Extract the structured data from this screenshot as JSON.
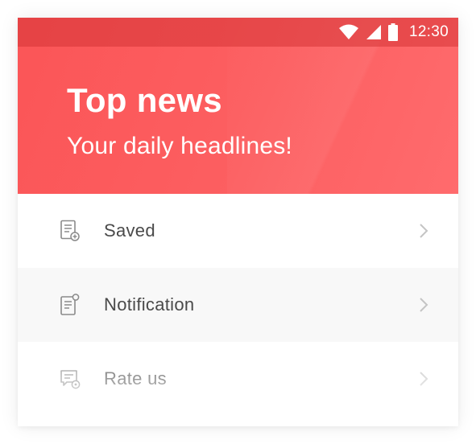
{
  "status_bar": {
    "time": "12:30",
    "icons": [
      "wifi-icon",
      "cell-signal-icon",
      "battery-icon"
    ]
  },
  "header": {
    "title": "Top news",
    "subtitle": "Your daily headlines!",
    "colors": {
      "accent": "#fb5557",
      "accent_light": "#ff6b6d"
    }
  },
  "menu": {
    "items": [
      {
        "label": "Saved",
        "icon": "saved-document-icon"
      },
      {
        "label": "Notification",
        "icon": "notification-document-icon"
      },
      {
        "label": "Rate us",
        "icon": "rate-chat-icon"
      }
    ]
  }
}
